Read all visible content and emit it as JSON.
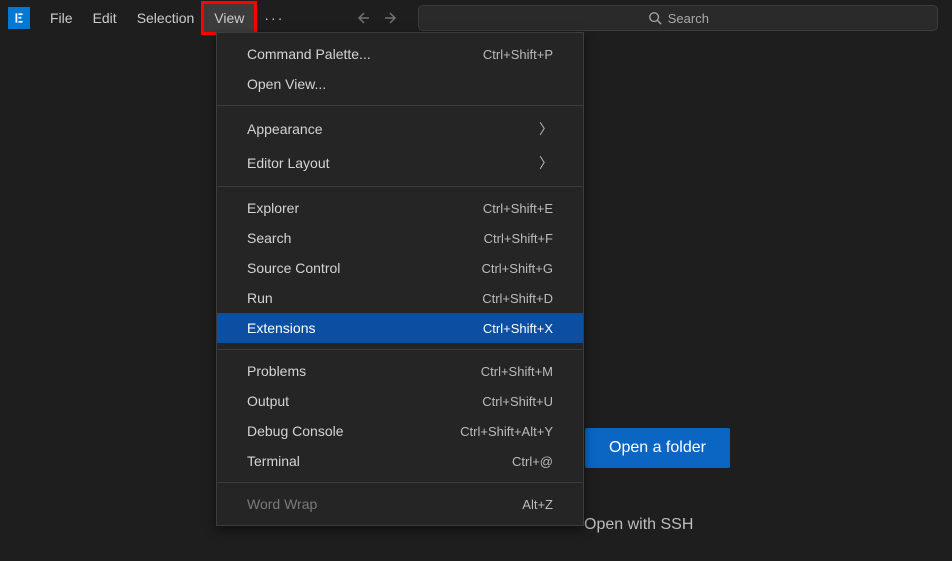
{
  "menubar": {
    "items": [
      "File",
      "Edit",
      "Selection",
      "View"
    ],
    "more": "···"
  },
  "search": {
    "placeholder": "Search"
  },
  "viewMenu": {
    "group1": [
      {
        "label": "Command Palette...",
        "shortcut": "Ctrl+Shift+P"
      },
      {
        "label": "Open View..."
      }
    ],
    "group2": [
      {
        "label": "Appearance",
        "submenu": true
      },
      {
        "label": "Editor Layout",
        "submenu": true
      }
    ],
    "group3": [
      {
        "label": "Explorer",
        "shortcut": "Ctrl+Shift+E"
      },
      {
        "label": "Search",
        "shortcut": "Ctrl+Shift+F"
      },
      {
        "label": "Source Control",
        "shortcut": "Ctrl+Shift+G"
      },
      {
        "label": "Run",
        "shortcut": "Ctrl+Shift+D"
      },
      {
        "label": "Extensions",
        "shortcut": "Ctrl+Shift+X",
        "selected": true
      }
    ],
    "group4": [
      {
        "label": "Problems",
        "shortcut": "Ctrl+Shift+M"
      },
      {
        "label": "Output",
        "shortcut": "Ctrl+Shift+U"
      },
      {
        "label": "Debug Console",
        "shortcut": "Ctrl+Shift+Alt+Y"
      },
      {
        "label": "Terminal",
        "shortcut": "Ctrl+@"
      }
    ],
    "group5": [
      {
        "label": "Word Wrap",
        "shortcut": "Alt+Z",
        "disabled": true
      }
    ]
  },
  "actions": {
    "openFolder": "Open a folder",
    "openSSH": "Open with SSH"
  }
}
